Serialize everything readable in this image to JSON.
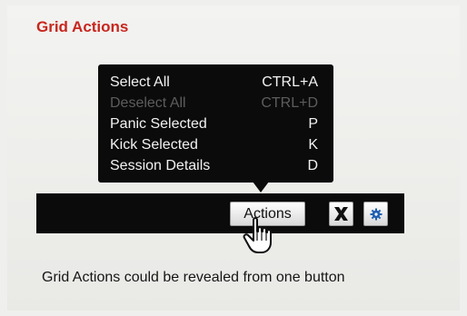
{
  "title": "Grid Actions",
  "menu": {
    "items": [
      {
        "label": "Select All",
        "shortcut": "CTRL+A",
        "enabled": true
      },
      {
        "label": "Deselect All",
        "shortcut": "CTRL+D",
        "enabled": false
      },
      {
        "label": "Panic Selected",
        "shortcut": "P",
        "enabled": true
      },
      {
        "label": "Kick Selected",
        "shortcut": "K",
        "enabled": true
      },
      {
        "label": "Session Details",
        "shortcut": "D",
        "enabled": true
      }
    ]
  },
  "toolbar": {
    "actions_label": "Actions",
    "close_icon": "close-x-icon",
    "settings_icon": "gear-icon"
  },
  "caption": "Grid Actions could be revealed from one button",
  "colors": {
    "title": "#c8261e",
    "menu_bg": "#0b0b0b",
    "menu_text": "#f2f2f2",
    "menu_disabled": "#5c5c5c",
    "settings_icon": "#1e5fb0"
  }
}
